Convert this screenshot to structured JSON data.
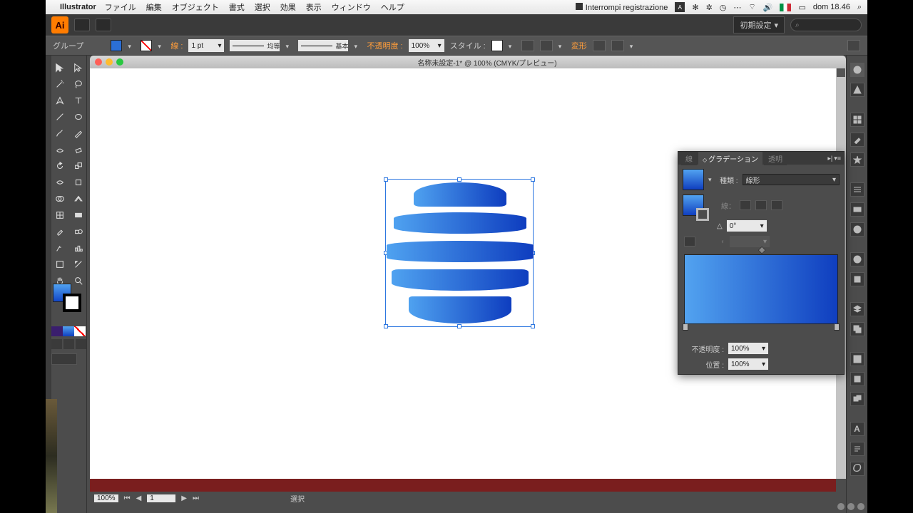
{
  "mac_menu": {
    "app": "Illustrator",
    "items": [
      "ファイル",
      "編集",
      "オブジェクト",
      "書式",
      "選択",
      "効果",
      "表示",
      "ウィンドウ",
      "ヘルプ"
    ],
    "recording": "Interrompi registrazione",
    "clock": "dom 18.46"
  },
  "titlebar": {
    "workspace": "初期設定",
    "search_placeholder": "⌕"
  },
  "control": {
    "selection_label": "グループ",
    "stroke_label": "線 :",
    "stroke_weight": "1 pt",
    "stroke_profile": "均等",
    "brush": "基本",
    "opacity_label": "不透明度 :",
    "opacity_value": "100%",
    "style_label": "スタイル :",
    "transform": "変形"
  },
  "doc": {
    "title": "名称未設定-1* @ 100% (CMYK/プレビュー)"
  },
  "status": {
    "zoom": "100%",
    "mode": "選択"
  },
  "gradient_panel": {
    "tabs": [
      "線",
      "グラデーション",
      "透明"
    ],
    "type_label": "種類 :",
    "type_value": "線形",
    "angle": "0°",
    "aspect": "",
    "opacity_label": "不透明度 :",
    "opacity_value": "100%",
    "location_label": "位置 :",
    "location_value": "100%"
  }
}
